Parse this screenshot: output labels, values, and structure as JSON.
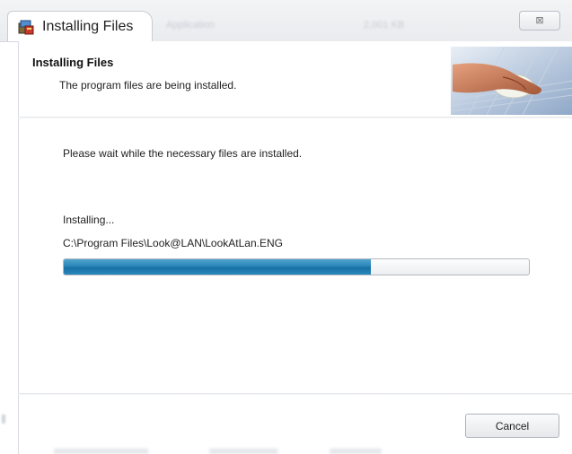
{
  "window": {
    "title": "Installing Files",
    "close_glyph": "⊠",
    "background_ghost_texts": [
      "Application",
      "2,001 KB"
    ]
  },
  "header": {
    "title": "Installing Files",
    "subtitle": "The program files are being installed."
  },
  "body": {
    "wait_message": "Please wait while the necessary files are installed.",
    "status_label": "Installing...",
    "current_file": "C:\\Program Files\\Look@LAN\\LookAtLan.ENG",
    "progress_fraction": 0.66
  },
  "footer": {
    "cancel_label": "Cancel"
  },
  "icons": {
    "app_icon": "installer-icon",
    "header_art": "hand-on-mouse-illustration",
    "close": "close-icon"
  },
  "colors": {
    "progress_fill": "#1670a5",
    "progress_track": "#eceef1"
  }
}
